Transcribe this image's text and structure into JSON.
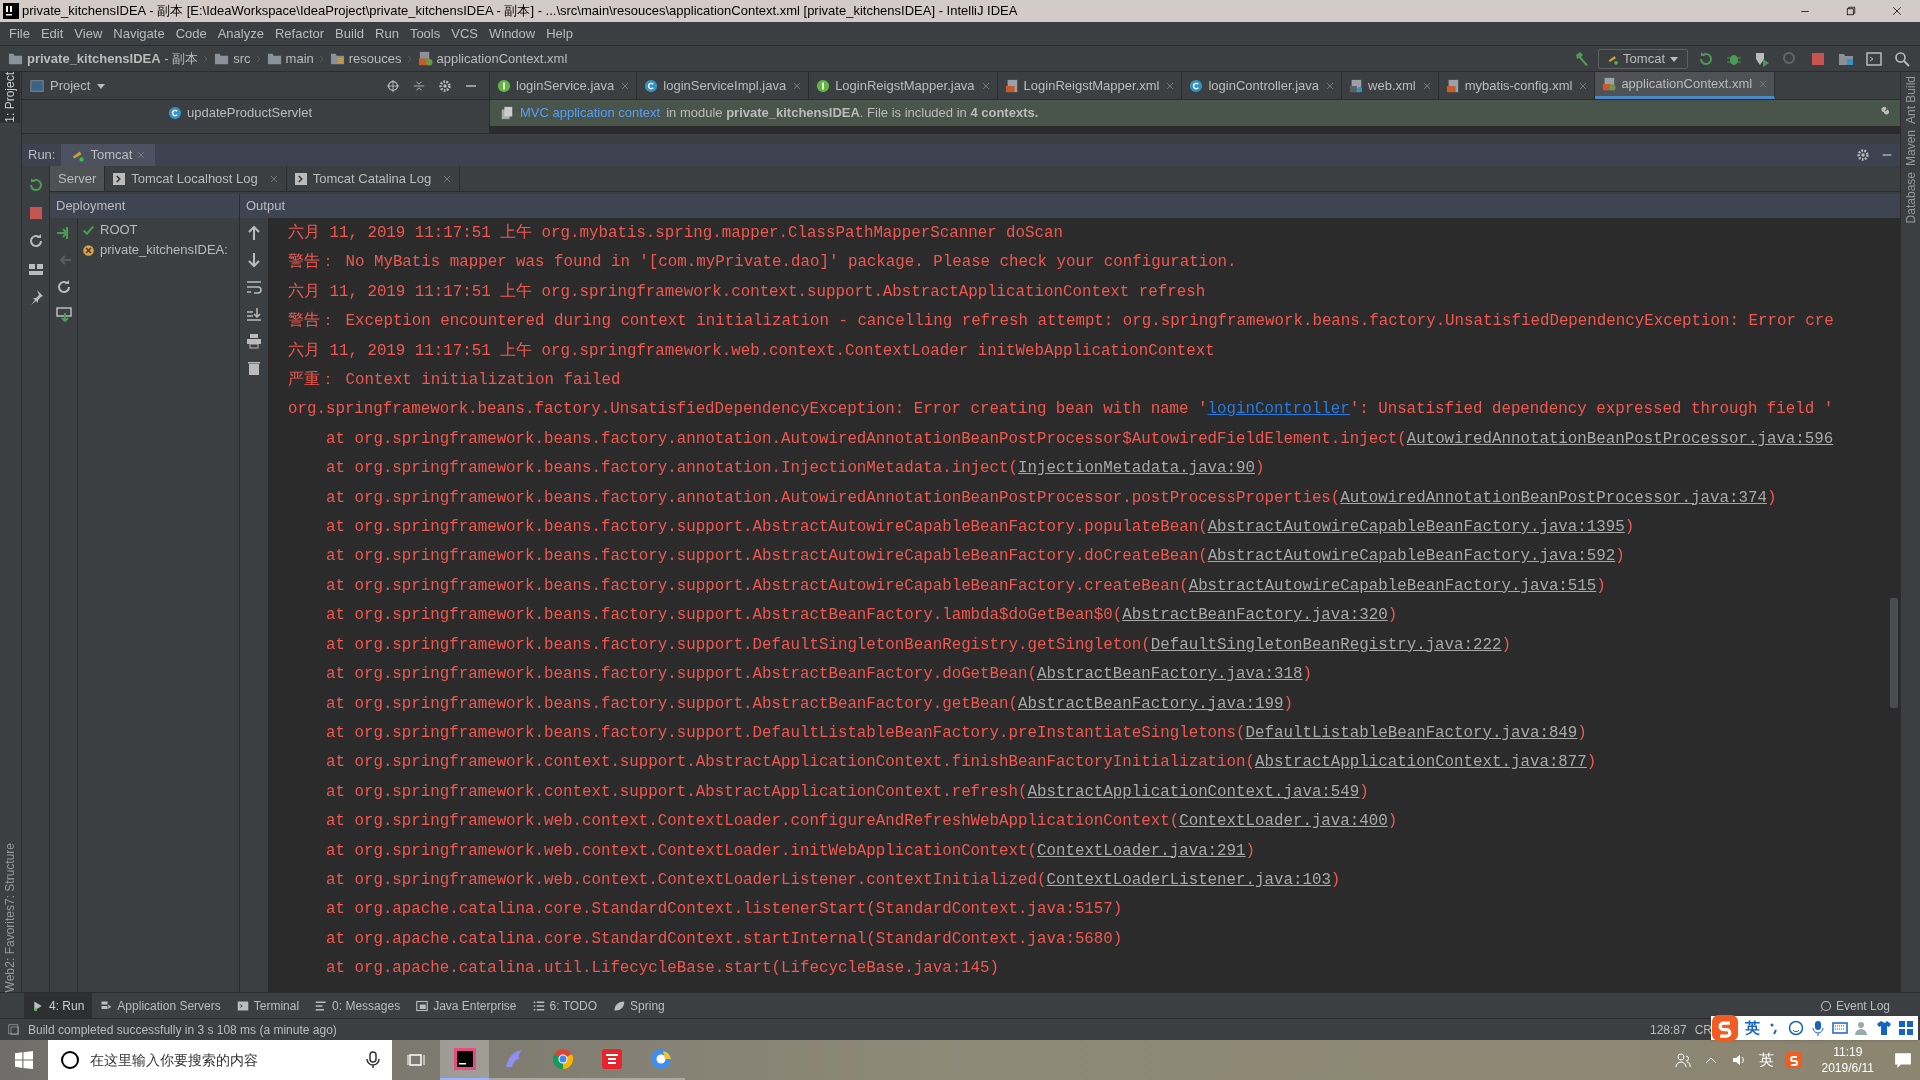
{
  "window": {
    "title": "private_kitchensIDEA - 副本 [E:\\IdeaWorkspace\\IdeaProject\\private_kitchensIDEA - 副本] - ...\\src\\main\\resouces\\applicationContext.xml [private_kitchensIDEA] - IntelliJ IDEA"
  },
  "menu": [
    "File",
    "Edit",
    "View",
    "Navigate",
    "Code",
    "Analyze",
    "Refactor",
    "Build",
    "Run",
    "Tools",
    "VCS",
    "Window",
    "Help"
  ],
  "breadcrumb": [
    {
      "kind": "project",
      "text": "**private_kitchensIDEA** - 副本"
    },
    {
      "kind": "folder",
      "text": "src"
    },
    {
      "kind": "folder",
      "text": "main"
    },
    {
      "kind": "resources",
      "text": "resouces"
    },
    {
      "kind": "file",
      "text": "applicationContext.xml"
    }
  ],
  "run_config": {
    "label": "Tomcat"
  },
  "side_tools": {
    "left": [
      {
        "label": "1: Project",
        "selected": true
      },
      {
        "label": "7: Structure",
        "selected": false
      },
      {
        "label": "2: Favorites",
        "selected": false
      },
      {
        "label": "Web",
        "selected": false
      }
    ],
    "right": [
      "Ant Build",
      "Maven",
      "Database"
    ]
  },
  "project_panel": {
    "title": "Project",
    "items": [
      "updateProductServlet"
    ]
  },
  "editor_tabs": [
    {
      "label": "loginService.java",
      "kind": "interface",
      "selected": false
    },
    {
      "label": "loginServiceImpl.java",
      "kind": "class",
      "selected": false
    },
    {
      "label": "LoginReigstMapper.java",
      "kind": "interface",
      "selected": false
    },
    {
      "label": "LoginReigstMapper.xml",
      "kind": "xml",
      "selected": false
    },
    {
      "label": "loginController.java",
      "kind": "class",
      "selected": false
    },
    {
      "label": "web.xml",
      "kind": "webxml",
      "selected": false
    },
    {
      "label": "mybatis-config.xml",
      "kind": "xml",
      "selected": false
    },
    {
      "label": "applicationContext.xml",
      "kind": "spring",
      "selected": true
    }
  ],
  "notification": {
    "link": "MVC application context",
    "text": "in module **private_kitchensIDEA**. File is included in **4 contexts.**"
  },
  "run": {
    "label": "Run:",
    "tab": "Tomcat",
    "subtabs": [
      {
        "label": "Server",
        "selected": true
      },
      {
        "label": "Tomcat Localhost Log",
        "selected": false
      },
      {
        "label": "Tomcat Catalina Log",
        "selected": false
      }
    ],
    "deployment_header": "Deployment",
    "output_header": "Output",
    "deployments": [
      {
        "name": "ROOT",
        "failed": false
      },
      {
        "name": "private_kitchensIDEA:",
        "failed": true
      }
    ],
    "lines": [
      {
        "kind": "message",
        "parts": [
          {
            "kind": "text",
            "text": "六月 11, 2019 11:17:51 上午 org.mybatis.spring.mapper.ClassPathMapperScanner doScan"
          }
        ]
      },
      {
        "kind": "message",
        "parts": [
          {
            "kind": "text",
            "text": "警告： No MyBatis mapper was found in '[com.myPrivate.dao]' package. Please check your configuration."
          }
        ]
      },
      {
        "kind": "message",
        "parts": [
          {
            "kind": "text",
            "text": "六月 11, 2019 11:17:51 上午 org.springframework.context.support.AbstractApplicationContext refresh"
          }
        ]
      },
      {
        "kind": "message",
        "parts": [
          {
            "kind": "text",
            "text": "警告： Exception encountered during context initialization - cancelling refresh attempt: org.springframework.beans.factory.UnsatisfiedDependencyException: Error cre"
          }
        ]
      },
      {
        "kind": "message",
        "parts": [
          {
            "kind": "text",
            "text": "六月 11, 2019 11:17:51 上午 org.springframework.web.context.ContextLoader initWebApplicationContext"
          }
        ]
      },
      {
        "kind": "message",
        "parts": [
          {
            "kind": "text",
            "text": "严重： Context initialization failed"
          }
        ]
      },
      {
        "kind": "message",
        "parts": [
          {
            "kind": "text",
            "text": "org.springframework.beans.factory.UnsatisfiedDependencyException: Error creating bean with name '"
          },
          {
            "kind": "link",
            "text": "loginController"
          },
          {
            "kind": "text",
            "text": "': Unsatisfied dependency expressed through field '"
          }
        ]
      },
      {
        "kind": "frame",
        "parts": [
          {
            "kind": "text",
            "text": "at org.springframework.beans.factory.annotation.AutowiredAnnotationBeanPostProcessor$AutowiredFieldElement.inject("
          },
          {
            "kind": "source",
            "text": "AutowiredAnnotationBeanPostProcessor.java:596"
          }
        ]
      },
      {
        "kind": "frame",
        "parts": [
          {
            "kind": "text",
            "text": "at org.springframework.beans.factory.annotation.InjectionMetadata.inject("
          },
          {
            "kind": "source",
            "text": "InjectionMetadata.java:90"
          },
          {
            "kind": "text",
            "text": ")"
          }
        ]
      },
      {
        "kind": "frame",
        "parts": [
          {
            "kind": "text",
            "text": "at org.springframework.beans.factory.annotation.AutowiredAnnotationBeanPostProcessor.postProcessProperties("
          },
          {
            "kind": "source",
            "text": "AutowiredAnnotationBeanPostProcessor.java:374"
          },
          {
            "kind": "text",
            "text": ")"
          }
        ]
      },
      {
        "kind": "frame",
        "parts": [
          {
            "kind": "text",
            "text": "at org.springframework.beans.factory.support.AbstractAutowireCapableBeanFactory.populateBean("
          },
          {
            "kind": "source",
            "text": "AbstractAutowireCapableBeanFactory.java:1395"
          },
          {
            "kind": "text",
            "text": ")"
          }
        ]
      },
      {
        "kind": "frame",
        "parts": [
          {
            "kind": "text",
            "text": "at org.springframework.beans.factory.support.AbstractAutowireCapableBeanFactory.doCreateBean("
          },
          {
            "kind": "source",
            "text": "AbstractAutowireCapableBeanFactory.java:592"
          },
          {
            "kind": "text",
            "text": ")"
          }
        ]
      },
      {
        "kind": "frame",
        "parts": [
          {
            "kind": "text",
            "text": "at org.springframework.beans.factory.support.AbstractAutowireCapableBeanFactory.createBean("
          },
          {
            "kind": "source",
            "text": "AbstractAutowireCapableBeanFactory.java:515"
          },
          {
            "kind": "text",
            "text": ")"
          }
        ]
      },
      {
        "kind": "frame",
        "parts": [
          {
            "kind": "text",
            "text": "at org.springframework.beans.factory.support.AbstractBeanFactory.lambda$doGetBean$0("
          },
          {
            "kind": "source",
            "text": "AbstractBeanFactory.java:320"
          },
          {
            "kind": "text",
            "text": ")"
          }
        ]
      },
      {
        "kind": "frame",
        "parts": [
          {
            "kind": "text",
            "text": "at org.springframework.beans.factory.support.DefaultSingletonBeanRegistry.getSingleton("
          },
          {
            "kind": "source",
            "text": "DefaultSingletonBeanRegistry.java:222"
          },
          {
            "kind": "text",
            "text": ")"
          }
        ]
      },
      {
        "kind": "frame",
        "parts": [
          {
            "kind": "text",
            "text": "at org.springframework.beans.factory.support.AbstractBeanFactory.doGetBean("
          },
          {
            "kind": "source",
            "text": "AbstractBeanFactory.java:318"
          },
          {
            "kind": "text",
            "text": ")"
          }
        ]
      },
      {
        "kind": "frame",
        "parts": [
          {
            "kind": "text",
            "text": "at org.springframework.beans.factory.support.AbstractBeanFactory.getBean("
          },
          {
            "kind": "source",
            "text": "AbstractBeanFactory.java:199"
          },
          {
            "kind": "text",
            "text": ")"
          }
        ]
      },
      {
        "kind": "frame",
        "parts": [
          {
            "kind": "text",
            "text": "at org.springframework.beans.factory.support.DefaultListableBeanFactory.preInstantiateSingletons("
          },
          {
            "kind": "source",
            "text": "DefaultListableBeanFactory.java:849"
          },
          {
            "kind": "text",
            "text": ")"
          }
        ]
      },
      {
        "kind": "frame",
        "parts": [
          {
            "kind": "text",
            "text": "at org.springframework.context.support.AbstractApplicationContext.finishBeanFactoryInitialization("
          },
          {
            "kind": "source",
            "text": "AbstractApplicationContext.java:877"
          },
          {
            "kind": "text",
            "text": ")"
          }
        ]
      },
      {
        "kind": "frame",
        "parts": [
          {
            "kind": "text",
            "text": "at org.springframework.context.support.AbstractApplicationContext.refresh("
          },
          {
            "kind": "source",
            "text": "AbstractApplicationContext.java:549"
          },
          {
            "kind": "text",
            "text": ")"
          }
        ]
      },
      {
        "kind": "frame",
        "parts": [
          {
            "kind": "text",
            "text": "at org.springframework.web.context.ContextLoader.configureAndRefreshWebApplicationContext("
          },
          {
            "kind": "source",
            "text": "ContextLoader.java:400"
          },
          {
            "kind": "text",
            "text": ")"
          }
        ]
      },
      {
        "kind": "frame",
        "parts": [
          {
            "kind": "text",
            "text": "at org.springframework.web.context.ContextLoader.initWebApplicationContext("
          },
          {
            "kind": "source",
            "text": "ContextLoader.java:291"
          },
          {
            "kind": "text",
            "text": ")"
          }
        ]
      },
      {
        "kind": "frame",
        "parts": [
          {
            "kind": "text",
            "text": "at org.springframework.web.context.ContextLoaderListener.contextInitialized("
          },
          {
            "kind": "source",
            "text": "ContextLoaderListener.java:103"
          },
          {
            "kind": "text",
            "text": ")"
          }
        ]
      },
      {
        "kind": "frame",
        "parts": [
          {
            "kind": "text",
            "text": "at org.apache.catalina.core.StandardContext.listenerStart(StandardContext.java:5157)"
          }
        ]
      },
      {
        "kind": "frame",
        "parts": [
          {
            "kind": "text",
            "text": "at org.apache.catalina.core.StandardContext.startInternal(StandardContext.java:5680)"
          }
        ]
      },
      {
        "kind": "frame",
        "parts": [
          {
            "kind": "text",
            "text": "at org.apache.catalina.util.LifecycleBase.start(LifecycleBase.java:145)"
          }
        ]
      }
    ]
  },
  "tool_tabs": [
    {
      "label": "4: Run",
      "kind": "run",
      "selected": true
    },
    {
      "label": "Application Servers",
      "kind": "servers",
      "selected": false
    },
    {
      "label": "Terminal",
      "kind": "terminal",
      "selected": false
    },
    {
      "label": "0: Messages",
      "kind": "messages",
      "selected": false
    },
    {
      "label": "Java Enterprise",
      "kind": "enterprise",
      "selected": false
    },
    {
      "label": "6: TODO",
      "kind": "todo",
      "selected": false
    },
    {
      "label": "Spring",
      "kind": "spring",
      "selected": false
    }
  ],
  "event_log": "Event Log",
  "status_bar": {
    "message": "Build completed successfully in 3 s 108 ms (a minute ago)",
    "position": "128:87",
    "line_separator": "CR"
  },
  "ime_bar": {
    "label": "英"
  },
  "taskbar": {
    "search_placeholder": "在这里输入你要搜索的内容",
    "apps": [
      {
        "kind": "idea",
        "selected": true
      },
      {
        "kind": "dolphin",
        "selected": false
      },
      {
        "kind": "chrome",
        "selected": false
      },
      {
        "kind": "youdao",
        "selected": false
      },
      {
        "kind": "browser",
        "selected": false
      }
    ],
    "language": "英",
    "time": "11:19",
    "date": "2019/6/11"
  }
}
